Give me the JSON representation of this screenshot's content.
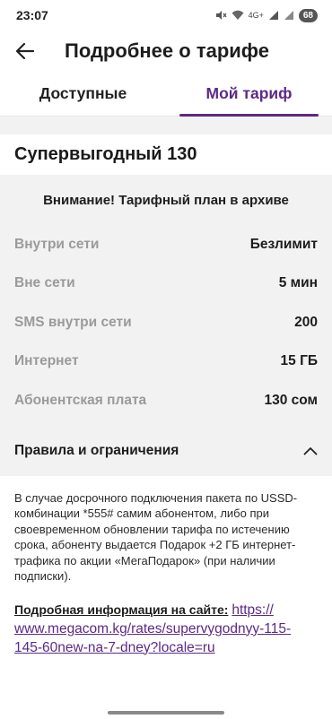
{
  "status_bar": {
    "time": "23:07",
    "network": "4G+",
    "battery": "68"
  },
  "header": {
    "title": "Подробнее о тарифе"
  },
  "tabs": [
    {
      "label": "Доступные",
      "active": false
    },
    {
      "label": "Мой тариф",
      "active": true
    }
  ],
  "plan": {
    "name": "Супервыгодный 130",
    "archive_notice": "Внимание! Тарифный план в архиве",
    "rows": [
      {
        "label": "Внутри сети",
        "value": "Безлимит"
      },
      {
        "label": "Вне сети",
        "value": "5 мин"
      },
      {
        "label": "SMS внутри сети",
        "value": "200"
      },
      {
        "label": "Интернет",
        "value": "15 ГБ"
      },
      {
        "label": "Абонентская плата",
        "value": "130 сом"
      }
    ]
  },
  "rules": {
    "title": "Правила и ограничения",
    "text": "В случае досрочного подключения пакета по USSD-комбинации *555# самим абонентом, либо при своевременном обновлении тарифа по истечению срока, абоненту выдается Подарок +2 ГБ интернет-трафика по акции «МегаПодарок» (при наличии подписки).",
    "more_label": "Подробная информация на сайте:",
    "more_link": "https://www.megacom.kg/rates/supervygodnyy-115-145-60new-na-7-dney?locale=ru"
  },
  "colors": {
    "accent": "#5c2a86",
    "card_bg": "#f2f2f2",
    "muted_label": "#9a9a9a"
  }
}
